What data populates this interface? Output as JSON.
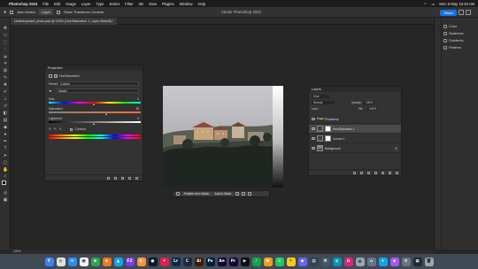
{
  "menubar": {
    "app_name": "Photoshop 2024",
    "menus": [
      "File",
      "Edit",
      "Image",
      "Layer",
      "Type",
      "Select",
      "Filter",
      "3D",
      "View",
      "Plugins",
      "Window",
      "Help"
    ],
    "clock": "Mon 6 May 10:49 AM"
  },
  "options_bar": {
    "auto_select": "Auto-Select",
    "layer_select": "Layer",
    "transform_controls": "Show Transform Controls",
    "window_title": "Adobe Photoshop 2024",
    "share": "Share"
  },
  "document": {
    "tab_label": "Underexposed_photo.psd @ 100% (Hue/Saturation 1, Layer Mask/8) *"
  },
  "properties_panel": {
    "title": "Properties",
    "subtitle": "Hue/Saturation",
    "preset_label": "Preset:",
    "preset_value": "Custom",
    "channel_value": "Master",
    "hue_label": "Hue:",
    "hue_value": 0,
    "saturation_label": "Saturation:",
    "saturation_value": 28,
    "lightness_label": "Lightness:",
    "lightness_value": 0,
    "colorize_label": "Colorize"
  },
  "context_bar": {
    "button1": "Feather from Mask",
    "button2": "Add to Mask"
  },
  "layers_panel": {
    "title": "Layers",
    "filter_kind": "Kind",
    "blend_mode": "Normal",
    "opacity_label": "Opacity:",
    "opacity_value": "100%",
    "lock_label": "Lock:",
    "fill_label": "Fill:",
    "fill_value": "100%",
    "layers": [
      {
        "name": "Photoshop",
        "type": "group",
        "selected": false
      },
      {
        "name": "Hue/Saturation 1",
        "type": "adjustment",
        "selected": true
      },
      {
        "name": "Curves 1",
        "type": "adjustment",
        "selected": false
      },
      {
        "name": "Background",
        "type": "image",
        "selected": false
      }
    ]
  },
  "right_panels": {
    "items": [
      "Color",
      "Swatches",
      "Gradients",
      "Patterns"
    ]
  },
  "status_bar": {
    "zoom": "100%"
  },
  "dock": {
    "apps": [
      {
        "label": "F",
        "color": "#3b82f6"
      },
      {
        "label": "◎",
        "color": "#e0e0e0"
      },
      {
        "label": "✉",
        "color": "#2d8cf0"
      },
      {
        "label": "▣",
        "color": "#f2f2f2"
      },
      {
        "label": "⊕",
        "color": "#2ea44f"
      },
      {
        "label": "◉",
        "color": "#f97316"
      },
      {
        "label": "▲",
        "color": "#0ea5e9"
      },
      {
        "label": "FZ",
        "color": "#7c3aed"
      },
      {
        "label": "◐",
        "color": "#fb923c"
      },
      {
        "label": "●",
        "color": "#111827"
      },
      {
        "label": "✦",
        "color": "#e11d48"
      },
      {
        "label": "Lr",
        "color": "#0b2a4a"
      },
      {
        "label": "C",
        "color": "#1e293b"
      },
      {
        "label": "Ai",
        "color": "#3b1d00"
      },
      {
        "label": "Ps",
        "color": "#001e36"
      },
      {
        "label": "Ae",
        "color": "#1a0033"
      },
      {
        "label": "Pr",
        "color": "#1a0033"
      },
      {
        "label": "▶",
        "color": "#111111"
      },
      {
        "label": "♪",
        "color": "#16a34a"
      },
      {
        "label": "⬢",
        "color": "#f59e0b"
      },
      {
        "label": "☰",
        "color": "#22c55e"
      },
      {
        "label": "✎",
        "color": "#facc15"
      },
      {
        "label": "◆",
        "color": "#6366f1"
      },
      {
        "label": "▤",
        "color": "#334155"
      },
      {
        "label": "⌘",
        "color": "#475569"
      },
      {
        "label": "◍",
        "color": "#0891b2"
      },
      {
        "label": "✿",
        "color": "#db2777"
      },
      {
        "label": "◒",
        "color": "#94a3b8"
      },
      {
        "label": "⌂",
        "color": "#64748b"
      },
      {
        "label": "✈",
        "color": "#0ea5e9"
      },
      {
        "label": "◈",
        "color": "#a855f7"
      },
      {
        "label": "⚙",
        "color": "#6b7280"
      },
      {
        "label": "▦",
        "color": "#1f2937"
      },
      {
        "label": "🗑",
        "color": "#9ca3af"
      }
    ]
  }
}
